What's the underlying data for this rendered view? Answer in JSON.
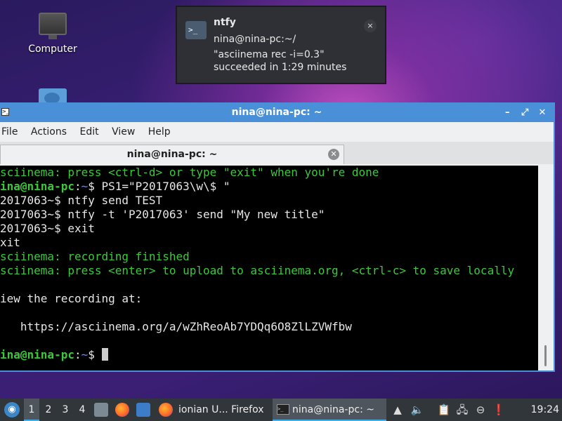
{
  "desktop": {
    "icons": [
      {
        "label": "Computer",
        "icon": "computer-icon"
      }
    ]
  },
  "notification": {
    "app": "ntfy",
    "icon": "terminal-icon",
    "icon_glyph": ">_",
    "line1": "nina@nina-pc:~/",
    "line2": "\"asciinema rec -i=0.3\"",
    "line3": "succeeded in 1:29 minutes",
    "close_glyph": "×"
  },
  "window": {
    "title": "nina@nina-pc: ~",
    "buttons": {
      "minimize": "–",
      "maximize": "⤢",
      "close": "✕"
    },
    "menu": [
      "File",
      "Actions",
      "Edit",
      "View",
      "Help"
    ],
    "tab": {
      "title": "nina@nina-pc: ~",
      "close_glyph": "✕"
    }
  },
  "terminal": {
    "lines": [
      {
        "green": "sciinema: press <ctrl-d> or type \"exit\" when you're done"
      },
      {
        "user": "ina@nina-pc",
        "sep": ":",
        "path": "~",
        "cmd": "$ PS1=\"P2017063\\w\\$ \""
      },
      {
        "text": "2017063~$ ntfy send TEST"
      },
      {
        "text": "2017063~$ ntfy -t 'P2017063' send \"My new title\""
      },
      {
        "text": "2017063~$ exit"
      },
      {
        "text": "xit"
      },
      {
        "green": "sciinema: recording finished"
      },
      {
        "green": "sciinema: press <enter> to upload to asciinema.org, <ctrl-c> to save locally"
      },
      {
        "text": ""
      },
      {
        "text": "iew the recording at:"
      },
      {
        "text": ""
      },
      {
        "text": "   https://asciinema.org/a/wZhReoAb7YDQq6O8ZlLZVWfbw"
      },
      {
        "text": ""
      },
      {
        "user": "ina@nina-pc",
        "sep": ":",
        "path": "~",
        "cmd": "$ "
      }
    ]
  },
  "taskbar": {
    "workspaces": [
      "1",
      "2",
      "3",
      "4"
    ],
    "active_workspace": "1",
    "tasks": [
      {
        "label": "ionian U... Firefox"
      },
      {
        "label": "nina@nina-pc: ~"
      }
    ],
    "clock": "19:24"
  }
}
